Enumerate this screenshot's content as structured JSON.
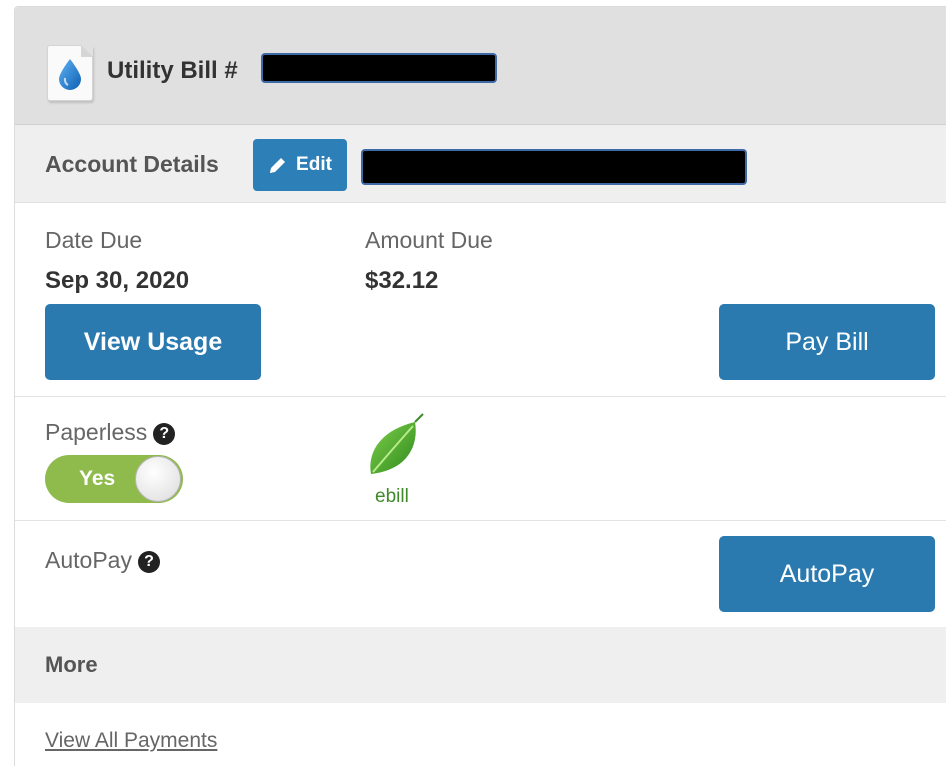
{
  "header": {
    "icon": "water-drop-icon",
    "title": "Utility Bill #"
  },
  "account_details": {
    "title": "Account Details",
    "edit_label": "Edit",
    "edit_icon": "pencil-icon"
  },
  "due": {
    "date_label": "Date Due",
    "date_value": "Sep 30, 2020",
    "amount_label": "Amount Due",
    "amount_value": "$32.12",
    "view_usage_label": "View Usage",
    "pay_bill_label": "Pay Bill"
  },
  "paperless": {
    "label": "Paperless",
    "help_icon": "question-circle-icon",
    "toggle_label": "Yes",
    "toggle_on": true,
    "ebill_label": "ebill",
    "ebill_icon": "leaf-icon"
  },
  "autopay": {
    "label": "AutoPay",
    "help_icon": "question-circle-icon",
    "button_label": "AutoPay"
  },
  "more": {
    "title": "More",
    "view_all_payments": "View All Payments"
  },
  "colors": {
    "primary_button": "#2a7ab0",
    "toggle_on": "#8fba4c",
    "ebill_green": "#3f8a2a"
  }
}
